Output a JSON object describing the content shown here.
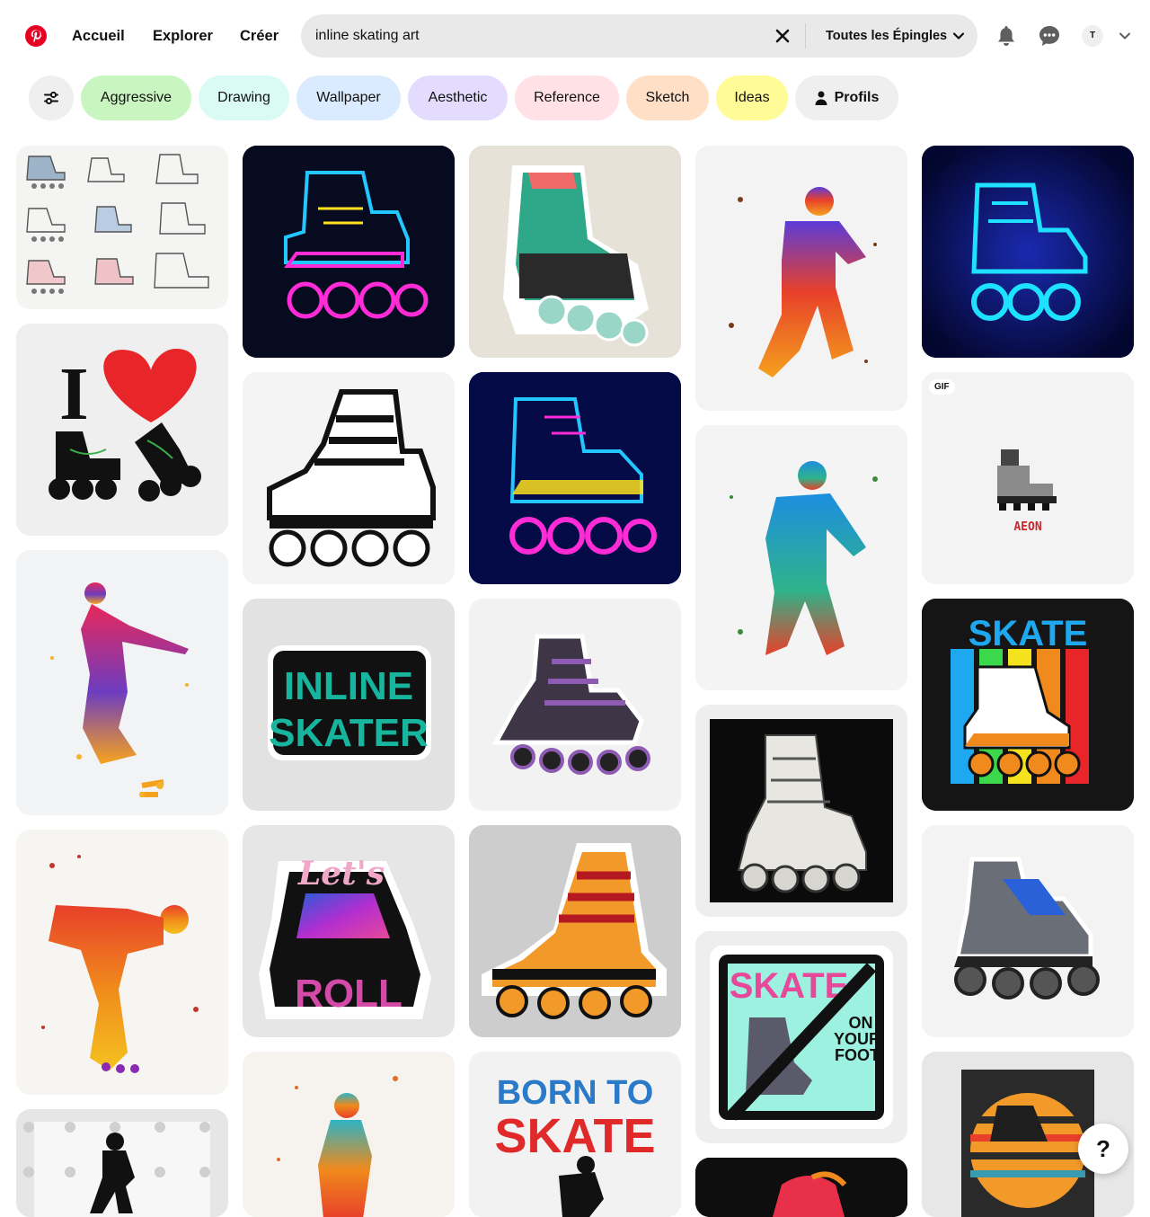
{
  "nav": {
    "home": "Accueil",
    "explore": "Explorer",
    "create": "Créer"
  },
  "search": {
    "value": "inline skating art",
    "scope": "Toutes les Épingles"
  },
  "account": {
    "initial": "T"
  },
  "filters": {
    "chips": [
      {
        "label": "Aggressive",
        "color": "#c9f5c0"
      },
      {
        "label": "Drawing",
        "color": "#d9fbf3"
      },
      {
        "label": "Wallpaper",
        "color": "#dbebff"
      },
      {
        "label": "Aesthetic",
        "color": "#e4dcff"
      },
      {
        "label": "Reference",
        "color": "#ffe1e6"
      },
      {
        "label": "Sketch",
        "color": "#ffe0c7"
      },
      {
        "label": "Ideas",
        "color": "#fffb96"
      }
    ],
    "profiles": "Profils"
  },
  "pins": {
    "gif_badge": "GIF",
    "texts": {
      "i_love": "I",
      "inline_skater": [
        "INLINE",
        "SKATER"
      ],
      "lets_roll": [
        "Let's",
        "ROLL"
      ],
      "born_to_skate": [
        "BORN TO",
        "SKATE"
      ],
      "skate": "SKATE",
      "skate_sticker": "SKATE",
      "on_your_foot": [
        "ON",
        "YOUR",
        "FOOT"
      ],
      "pixel_caption": "AEON"
    }
  },
  "help": {
    "label": "?"
  },
  "colors": {
    "brand": "#e60023",
    "search_bg": "#e9e9e9",
    "chip_neutral": "#efefef"
  }
}
